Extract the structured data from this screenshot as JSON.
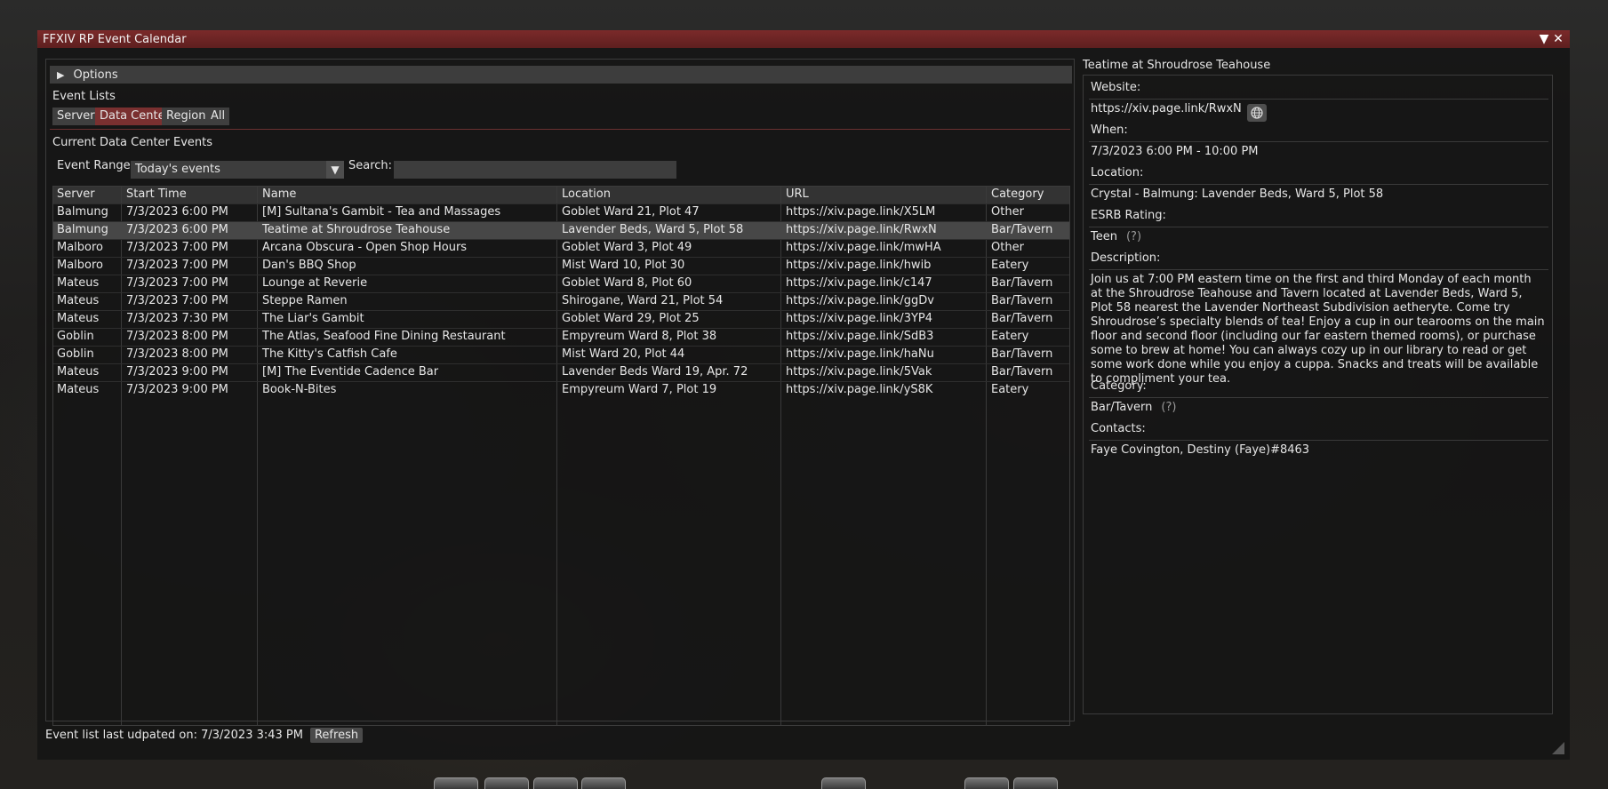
{
  "window": {
    "title": "FFXIV RP Event Calendar"
  },
  "options": {
    "label": "Options"
  },
  "event_lists": {
    "heading": "Event Lists",
    "tabs": [
      "Server",
      "Data Center",
      "Region",
      "All"
    ],
    "active_tab": "Data Center",
    "current_heading": "Current Data Center Events"
  },
  "filters": {
    "range_label": "Event Range:",
    "range_value": "Today's events",
    "search_label": "Search:",
    "search_value": ""
  },
  "table": {
    "columns": [
      "Server",
      "Start Time",
      "Name",
      "Location",
      "URL",
      "Category"
    ],
    "rows": [
      [
        "Balmung",
        "7/3/2023 6:00 PM",
        "[M] Sultana's Gambit - Tea and Massages",
        "Goblet Ward 21, Plot 47",
        "https://xiv.page.link/X5LM",
        "Other"
      ],
      [
        "Balmung",
        "7/3/2023 6:00 PM",
        "Teatime at Shroudrose Teahouse",
        "Lavender Beds, Ward 5, Plot 58",
        "https://xiv.page.link/RwxN",
        "Bar/Tavern"
      ],
      [
        "Malboro",
        "7/3/2023 7:00 PM",
        "Arcana Obscura - Open Shop Hours",
        "Goblet Ward 3, Plot 49",
        "https://xiv.page.link/mwHA",
        "Other"
      ],
      [
        "Malboro",
        "7/3/2023 7:00 PM",
        "Dan's BBQ Shop",
        "Mist Ward 10, Plot 30",
        "https://xiv.page.link/hwib",
        "Eatery"
      ],
      [
        "Mateus",
        "7/3/2023 7:00 PM",
        "Lounge at Reverie",
        "Goblet Ward 8, Plot 60",
        "https://xiv.page.link/c147",
        "Bar/Tavern"
      ],
      [
        "Mateus",
        "7/3/2023 7:00 PM",
        "Steppe Ramen",
        "Shirogane, Ward 21, Plot 54",
        "https://xiv.page.link/ggDv",
        "Bar/Tavern"
      ],
      [
        "Mateus",
        "7/3/2023 7:30 PM",
        "The Liar's Gambit",
        "Goblet Ward 29, Plot 25",
        "https://xiv.page.link/3YP4",
        "Bar/Tavern"
      ],
      [
        "Goblin",
        "7/3/2023 8:00 PM",
        "The Atlas, Seafood Fine Dining Restaurant",
        "Empyreum Ward 8, Plot 38",
        "https://xiv.page.link/SdB3",
        "Eatery"
      ],
      [
        "Goblin",
        "7/3/2023 8:00 PM",
        "The Kitty's Catfish Cafe",
        "Mist Ward 20, Plot 44",
        "https://xiv.page.link/haNu",
        "Bar/Tavern"
      ],
      [
        "Mateus",
        "7/3/2023 9:00 PM",
        "[M] The Eventide Cadence Bar",
        "Lavender Beds Ward 19, Apr. 72",
        "https://xiv.page.link/5Vak",
        "Bar/Tavern"
      ],
      [
        "Mateus",
        "7/3/2023 9:00 PM",
        "Book-N-Bites",
        "Empyreum Ward 7, Plot 19",
        "https://xiv.page.link/yS8K",
        "Eatery"
      ]
    ],
    "selected_row": 1
  },
  "detail": {
    "title": "Teatime at Shroudrose Teahouse",
    "website_label": "Website:",
    "website": "https://xiv.page.link/RwxN",
    "when_label": "When:",
    "when": "7/3/2023 6:00 PM - 10:00 PM",
    "location_label": "Location:",
    "location": "Crystal - Balmung: Lavender Beds, Ward 5, Plot 58",
    "esrb_label": "ESRB Rating:",
    "esrb": "Teen",
    "help": "(?)",
    "description_label": "Description:",
    "description": "Join us at 7:00 PM eastern time on the first and third Monday of each month at the Shroudrose Teahouse and Tavern located at Lavender Beds, Ward 5, Plot 58 nearest the Lavender Northeast Subdivision aetheryte. Come try Shroudrose’s specialty blends of tea! Enjoy a cup in our tearooms on the main floor and second floor (including our far eastern themed rooms), or purchase some to brew at home! You can always cozy up in our library to read or get some work done while you enjoy a cuppa. Snacks and treats will be available to compliment your tea.",
    "category_label": "Category:",
    "category": "Bar/Tavern",
    "contacts_label": "Contacts:",
    "contacts": "Faye Covington, Destiny (Faye)#8463"
  },
  "footer": {
    "updated_text": "Event list last udpated on: 7/3/2023 3:43 PM",
    "refresh_label": "Refresh"
  },
  "colors": {
    "title_bar": "#6b2525",
    "active_tab": "#7a3030"
  }
}
